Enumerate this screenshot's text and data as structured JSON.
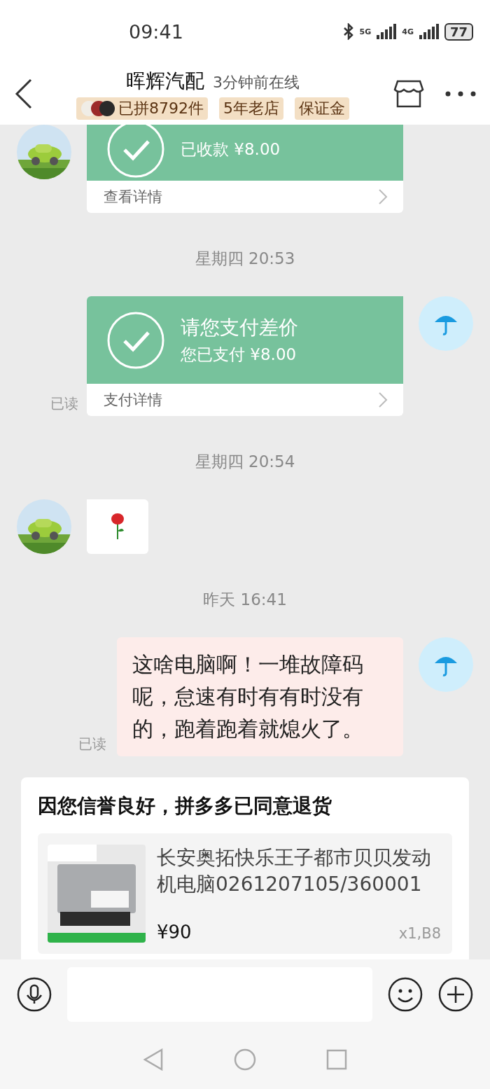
{
  "status_bar": {
    "time": "09:41",
    "network_1": "5G",
    "network_2": "4G",
    "battery": "77"
  },
  "header": {
    "title": "晖辉汽配",
    "online": "3分钟前在线",
    "badges": [
      {
        "kind": "avatars",
        "label": "已拼8792件"
      },
      {
        "kind": "plain",
        "label": "5年老店"
      },
      {
        "kind": "plain",
        "label": "保证金"
      }
    ]
  },
  "messages": [
    {
      "kind": "payment",
      "outgoing": false,
      "cut": true,
      "amount": "已收款 ¥8.00",
      "link": "查看详情"
    },
    {
      "kind": "time",
      "text": "星期四 20:53"
    },
    {
      "kind": "payment",
      "outgoing": true,
      "cut": false,
      "title": "请您支付差价",
      "amount": "您已支付 ¥8.00",
      "link": "支付详情",
      "read": "已读"
    },
    {
      "kind": "time",
      "text": "星期四 20:54"
    },
    {
      "kind": "sticker",
      "outgoing": false
    },
    {
      "kind": "time",
      "text": "昨天 16:41"
    },
    {
      "kind": "text",
      "outgoing": true,
      "text": "这啥电脑啊！一堆故障码呢，怠速有时有有时没有的，跑着跑着就熄火了。",
      "read": "已读"
    },
    {
      "kind": "order",
      "title": "因您信誉良好，拼多多已同意退货",
      "product": {
        "name": "长安奥拓快乐王子都市贝贝发动机电脑0261207105/360001",
        "price": "¥90",
        "qty": "x1,B8"
      }
    }
  ]
}
